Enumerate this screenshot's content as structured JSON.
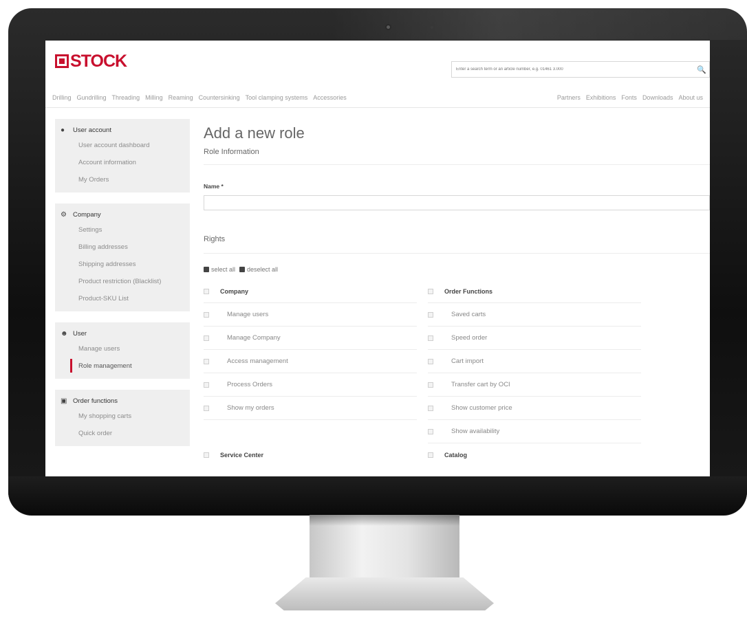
{
  "brand": {
    "name": "STOCK",
    "accent": "#c8102e"
  },
  "search": {
    "placeholder": "Enter a search term or an article number, e.g. 01461 3.000"
  },
  "nav": {
    "left": [
      "Drilling",
      "Gundrilling",
      "Threading",
      "Milling",
      "Reaming",
      "Countersinking",
      "Tool clamping systems",
      "Accessories"
    ],
    "right": [
      "Partners",
      "Exhibitions",
      "Fonts",
      "Downloads",
      "About us"
    ]
  },
  "sidebar": {
    "groups": [
      {
        "title": "User account",
        "icon": "user-icon",
        "items": [
          "User account dashboard",
          "Account information",
          "My Orders"
        ]
      },
      {
        "title": "Company",
        "icon": "gear-icon",
        "items": [
          "Settings",
          "Billing addresses",
          "Shipping addresses",
          "Product restriction (Blacklist)",
          "Product-SKU List"
        ]
      },
      {
        "title": "User",
        "icon": "users-icon",
        "items": [
          "Manage users",
          "Role management"
        ],
        "active": "Role management"
      },
      {
        "title": "Order functions",
        "icon": "cart-icon",
        "items": [
          "My shopping carts",
          "Quick order"
        ]
      }
    ]
  },
  "main": {
    "title": "Add a new role",
    "role_info": "Role Information",
    "name_label": "Name *",
    "rights_title": "Rights",
    "select_all": "select all",
    "deselect_all": "deselect all",
    "left_col": {
      "head": "Company",
      "items": [
        "Manage users",
        "Manage Company",
        "Access management",
        "Process Orders",
        "Show my orders"
      ],
      "next_head": "Service Center"
    },
    "right_col": {
      "head": "Order Functions",
      "items": [
        "Saved carts",
        "Speed order",
        "Cart import",
        "Transfer cart by OCI",
        "Show customer price",
        "Show availability"
      ],
      "next_head": "Catalog"
    }
  }
}
